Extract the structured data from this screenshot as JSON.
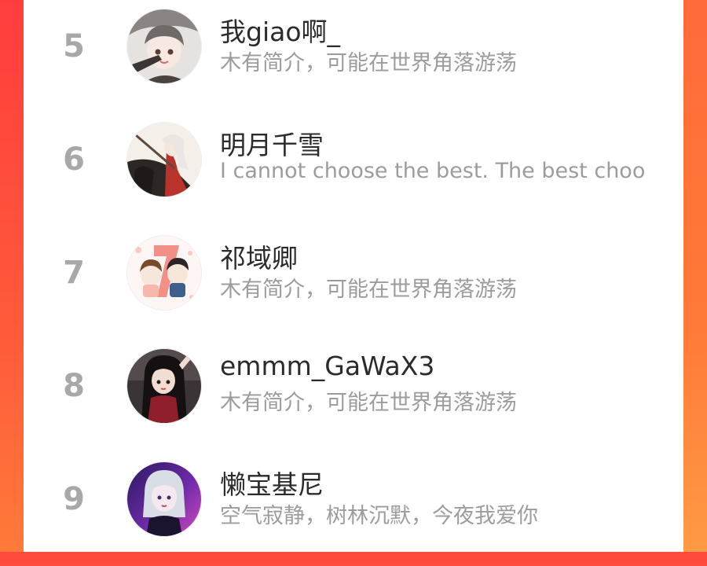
{
  "ranking": {
    "items": [
      {
        "rank": "5",
        "name": "我giao啊_",
        "bio": "木有简介，可能在世界角落游荡"
      },
      {
        "rank": "6",
        "name": "明月千雪",
        "bio": "I cannot choose the best. The best choo"
      },
      {
        "rank": "7",
        "name": "祁域卿",
        "bio": "木有简介，可能在世界角落游荡"
      },
      {
        "rank": "8",
        "name": "emmm_GaWaX3",
        "bio": "木有简介，可能在世界角落游荡"
      },
      {
        "rank": "9",
        "name": "懒宝基尼",
        "bio": "空气寂静，树林沉默，今夜我爱你"
      }
    ]
  },
  "colors": {
    "background_accent": "#ff5a3c",
    "rank_number": "#a8a8a8",
    "name_text": "#2b2b2b",
    "bio_text": "#9c9c9c"
  }
}
